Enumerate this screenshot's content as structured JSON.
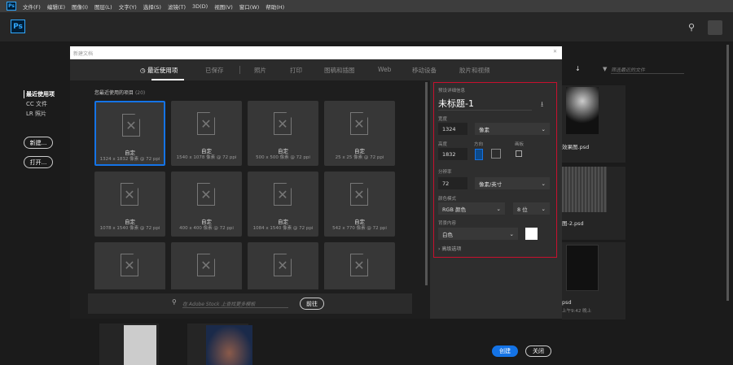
{
  "menubar": {
    "items": [
      "文件(F)",
      "编辑(E)",
      "图像(I)",
      "图层(L)",
      "文字(Y)",
      "选择(S)",
      "滤镜(T)",
      "3D(D)",
      "视图(V)",
      "窗口(W)",
      "帮助(H)"
    ]
  },
  "app": {
    "logo": "Ps"
  },
  "sidebar": {
    "items": [
      "最近使用项",
      "CC 文件",
      "LR 照片"
    ],
    "new_label": "新建...",
    "open_label": "打开..."
  },
  "home": {
    "filter_placeholder": "筛选最近的文件",
    "files": [
      "效果图.psd",
      "图-2.psd",
      "psd"
    ],
    "file3_time": "上午9:42 晚上"
  },
  "dialog": {
    "title": "新建文档",
    "tabs": [
      "最近使用项",
      "已保存",
      "照片",
      "打印",
      "图稿和插图",
      "Web",
      "移动设备",
      "胶片和视频"
    ],
    "section_title": "您最近使用的项目",
    "count": "(20)",
    "tiles": [
      {
        "name": "自定",
        "size": "1324 x 1832 像素 @ 72 ppi"
      },
      {
        "name": "自定",
        "size": "1540 x 1078 像素 @ 72 ppi"
      },
      {
        "name": "自定",
        "size": "500 x 500 像素 @ 72 ppi"
      },
      {
        "name": "自定",
        "size": "25 x 25 像素 @ 72 ppi"
      },
      {
        "name": "自定",
        "size": "1078 x 1540 像素 @ 72 ppi"
      },
      {
        "name": "自定",
        "size": "400 x 400 像素 @ 72 ppi"
      },
      {
        "name": "自定",
        "size": "1084 x 1540 像素 @ 72 ppi"
      },
      {
        "name": "自定",
        "size": "542 x 770 像素 @ 72 ppi"
      },
      {
        "name": "",
        "size": ""
      },
      {
        "name": "",
        "size": ""
      },
      {
        "name": "",
        "size": ""
      },
      {
        "name": "",
        "size": ""
      }
    ],
    "stock_search_placeholder": "在 Adobe Stock 上查找更多模板",
    "go_label": "前往",
    "details": {
      "header": "预设详细信息",
      "doc_name": "未标题-1",
      "width_label": "宽度",
      "width": "1324",
      "width_unit": "像素",
      "height_label": "高度",
      "height": "1832",
      "orientation_label": "方向",
      "artboard_label": "画板",
      "resolution_label": "分辨率",
      "resolution": "72",
      "resolution_unit": "像素/英寸",
      "color_mode_label": "颜色模式",
      "color_mode": "RGB 颜色",
      "bit_depth": "8 位",
      "background_label": "背景内容",
      "background": "白色",
      "background_color": "#ffffff",
      "advanced_label": "高级选项"
    },
    "create_label": "创建",
    "close_label": "关闭"
  },
  "colors": {
    "accent": "#1473e6",
    "highlight": "#c8102e"
  }
}
